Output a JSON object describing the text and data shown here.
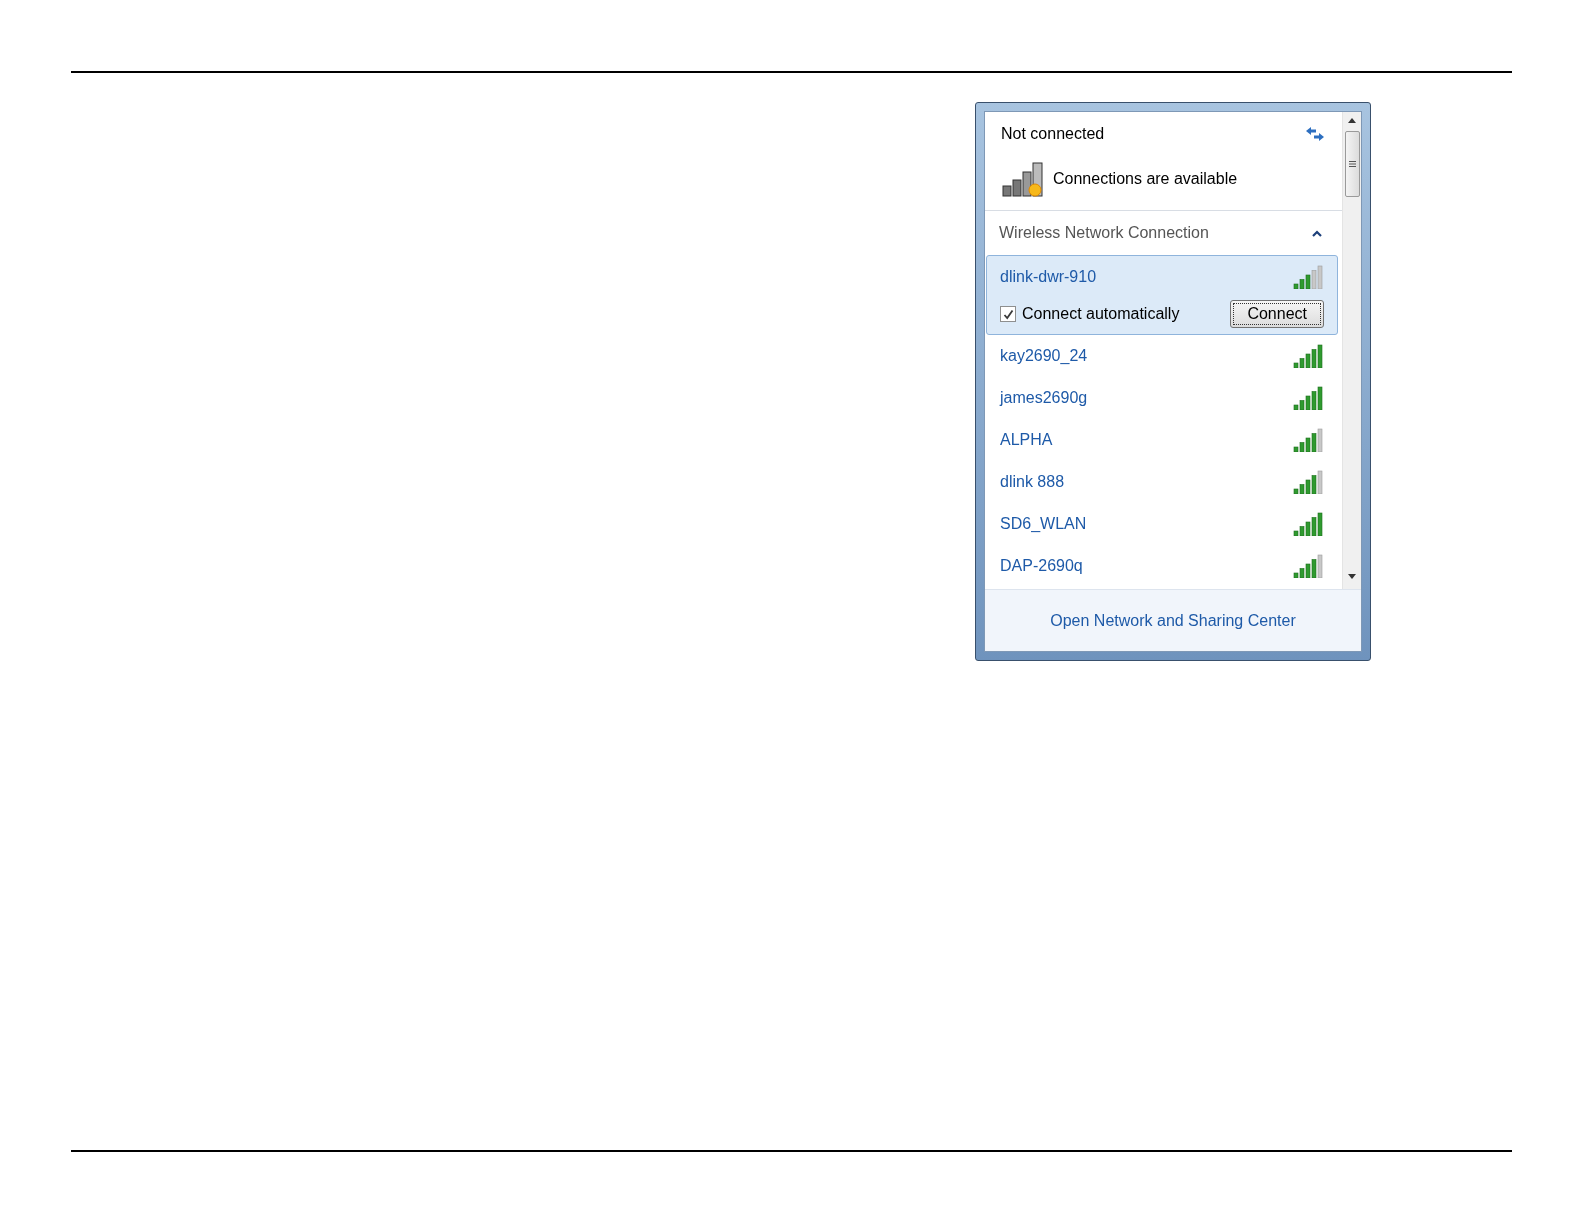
{
  "status": {
    "title": "Not connected",
    "message": "Connections are available"
  },
  "section": {
    "title": "Wireless Network Connection",
    "expanded": true
  },
  "networks": [
    {
      "name": "dlink-dwr-910",
      "level": 0.6,
      "selected": true,
      "connect_automatically": {
        "label": "Connect automatically",
        "checked": true
      },
      "button": "Connect"
    },
    {
      "name": "kay2690_24",
      "level": 1,
      "selected": false
    },
    {
      "name": "james2690g",
      "level": 1,
      "selected": false
    },
    {
      "name": "ALPHA",
      "level": 0.8,
      "selected": false
    },
    {
      "name": "dlink 888",
      "level": 0.8,
      "selected": false
    },
    {
      "name": "SD6_WLAN",
      "level": 1,
      "selected": false
    },
    {
      "name": "DAP-2690q",
      "level": 0.8,
      "selected": false
    }
  ],
  "footer_link": "Open Network and Sharing Center"
}
